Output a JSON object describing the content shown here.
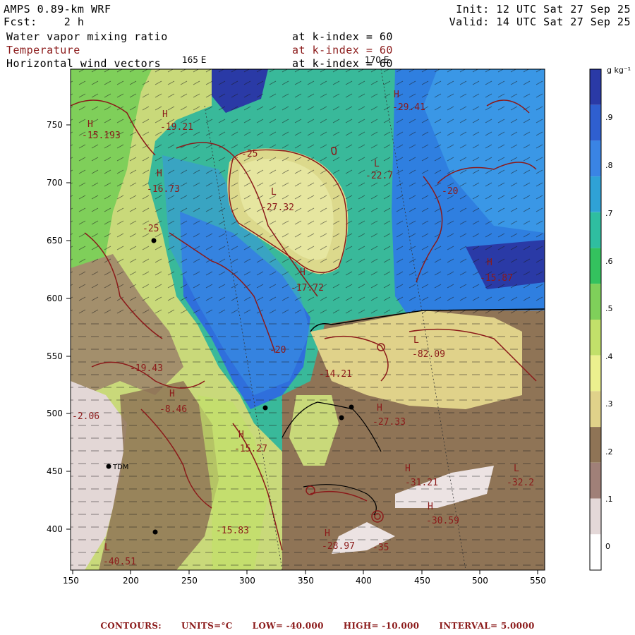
{
  "header": {
    "model": "AMPS 0.89-km WRF",
    "fcst_label": "Fcst:",
    "fcst_value": "2 h",
    "init": "Init: 12 UTC Sat 27 Sep 25",
    "valid": "Valid: 14 UTC Sat 27 Sep 25",
    "fields": [
      {
        "name": "Water vapor mixing ratio",
        "level": "at k-index = 60",
        "color": "#000000"
      },
      {
        "name": "Temperature",
        "level": "at k-index = 60",
        "color": "#8b1a1a"
      },
      {
        "name": "Horizontal wind vectors",
        "level": "at k-index = 60",
        "color": "#000000"
      }
    ]
  },
  "map": {
    "longitude_labels": [
      "165 E",
      "170 E"
    ],
    "x_ticks": [
      "150",
      "200",
      "250",
      "300",
      "350",
      "400",
      "450",
      "500",
      "550"
    ],
    "y_ticks": [
      "400",
      "450",
      "500",
      "550",
      "600",
      "650",
      "700",
      "750"
    ],
    "station_label": "TDM"
  },
  "colorbar": {
    "unit": "g kg⁻¹",
    "labels": [
      ".9",
      ".8",
      ".7",
      ".6",
      ".5",
      ".4",
      ".3",
      ".2",
      ".1",
      "0"
    ],
    "colors": [
      "#2a3aa6",
      "#2f5fd0",
      "#3a84e4",
      "#2fa2d6",
      "#2fbea0",
      "#34c25e",
      "#7fd05a",
      "#c2e06a",
      "#ecf08e",
      "#e0d28a",
      "#8f7456",
      "#a08078",
      "#e4d8d8",
      "#ffffff"
    ]
  },
  "temperature_labels": [
    {
      "kind": "H",
      "value": "-29.41"
    },
    {
      "kind": "H",
      "value": "-19.21"
    },
    {
      "kind": "H",
      "value": "-15.193"
    },
    {
      "kind": "",
      "value": "-25"
    },
    {
      "kind": "L",
      "value": "-22.7"
    },
    {
      "kind": "",
      "value": "-20"
    },
    {
      "kind": "H",
      "value": "-16.73"
    },
    {
      "kind": "L",
      "value": "-27.32"
    },
    {
      "kind": "H",
      "value": "-15.87"
    },
    {
      "kind": "H",
      "value": "-17.72"
    },
    {
      "kind": "",
      "value": "-20"
    },
    {
      "kind": "L",
      "value": "-82.09"
    },
    {
      "kind": "H",
      "value": "-27.33"
    },
    {
      "kind": "H",
      "value": "-31.21"
    },
    {
      "kind": "L",
      "value": "-32.2"
    },
    {
      "kind": "H",
      "value": "-30.59"
    },
    {
      "kind": "H",
      "value": "-28.97"
    },
    {
      "kind": "",
      "value": "-35"
    },
    {
      "kind": "H",
      "value": "-15.27"
    },
    {
      "kind": "",
      "value": "-2.06"
    },
    {
      "kind": "L",
      "value": "-40.51"
    },
    {
      "kind": "",
      "value": "-25"
    },
    {
      "kind": "",
      "value": "-19.43"
    },
    {
      "kind": "H",
      "value": "-8.46"
    },
    {
      "kind": "",
      "value": "-14.21"
    },
    {
      "kind": "",
      "value": "-15.83"
    }
  ],
  "footer": {
    "contours": "CONTOURS:",
    "units": "UNITS=°C",
    "low": "LOW= -40.000",
    "high": "HIGH= -10.000",
    "interval": "INTERVAL= 5.0000"
  }
}
